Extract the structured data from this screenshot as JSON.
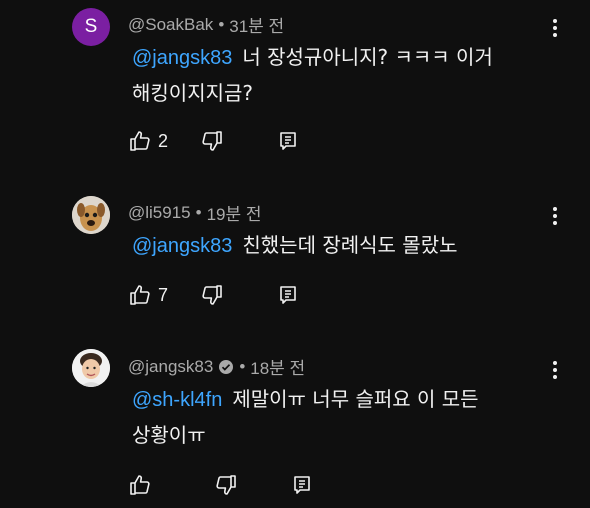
{
  "comments": [
    {
      "author": "@SoakBak",
      "time": "31분 전",
      "avatar_letter": "S",
      "avatar_color": "#7b1fa2",
      "mention": "@jangsk83",
      "text_line1": "너 장성규아니지? ㅋㅋㅋ 이거",
      "text_line2": "해킹이지지금?",
      "likes": "2",
      "verified": false
    },
    {
      "author": "@li5915",
      "time": "19분 전",
      "avatar_desc": "dog-photo",
      "mention": "@jangsk83",
      "text_line1": "친했는데 장례식도 몰랐노",
      "likes": "7",
      "verified": false
    },
    {
      "author": "@jangsk83",
      "time": "18분 전",
      "avatar_desc": "person-photo",
      "mention": "@sh-kl4fn",
      "text_line1": "제말이ㅠ 너무 슬퍼요 이 모든",
      "text_line2": "상황이ㅠ",
      "likes": "",
      "verified": true
    }
  ],
  "colors": {
    "background": "#0f0f0f",
    "text": "#f1f1f1",
    "meta": "#aaaaaa",
    "mention": "#3ea6ff"
  },
  "separator": "•"
}
